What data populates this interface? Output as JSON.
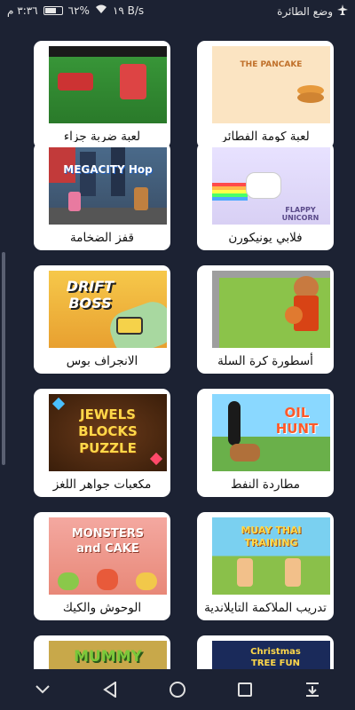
{
  "status": {
    "time": "٣:٣٦ م",
    "network_speed": "١٩ B/s",
    "battery_percent": "٦٢%",
    "battery_level": 0.62,
    "airplane_mode_label": "وضع الطائرة"
  },
  "games": [
    {
      "title": "لعبة ضربة جزاء",
      "thumb_text": ""
    },
    {
      "title": "لعبة كومة الفطائر",
      "thumb_text": "THE PANCAKE"
    },
    {
      "title": "قفز الضخامة",
      "thumb_text": "MEGACITY Hop"
    },
    {
      "title": "فلابي يونيكورن",
      "thumb_text": "FLAPPY UNICORN"
    },
    {
      "title": "الانجراف بوس",
      "thumb_text": "DRIFT BOSS"
    },
    {
      "title": "أسطورة كرة السلة",
      "thumb_text": ""
    },
    {
      "title": "مكعبات جواهر اللغز",
      "thumb_text": "JEWELS BLOCKS PUZZLE"
    },
    {
      "title": "مطاردة النفط",
      "thumb_text": "OIL HUNT"
    },
    {
      "title": "الوحوش والكيك",
      "thumb_text": "MONSTERS and CAKE"
    },
    {
      "title": "تدريب الملاكمة التايلاندية",
      "thumb_text": "MUAY THAI TRAINING"
    },
    {
      "title": "",
      "thumb_text": "MUMMY"
    },
    {
      "title": "",
      "thumb_text": "Christmas TREE FUN"
    }
  ],
  "colors": {
    "background": "#1c2233",
    "card": "#ffffff",
    "label_text": "#111111"
  }
}
